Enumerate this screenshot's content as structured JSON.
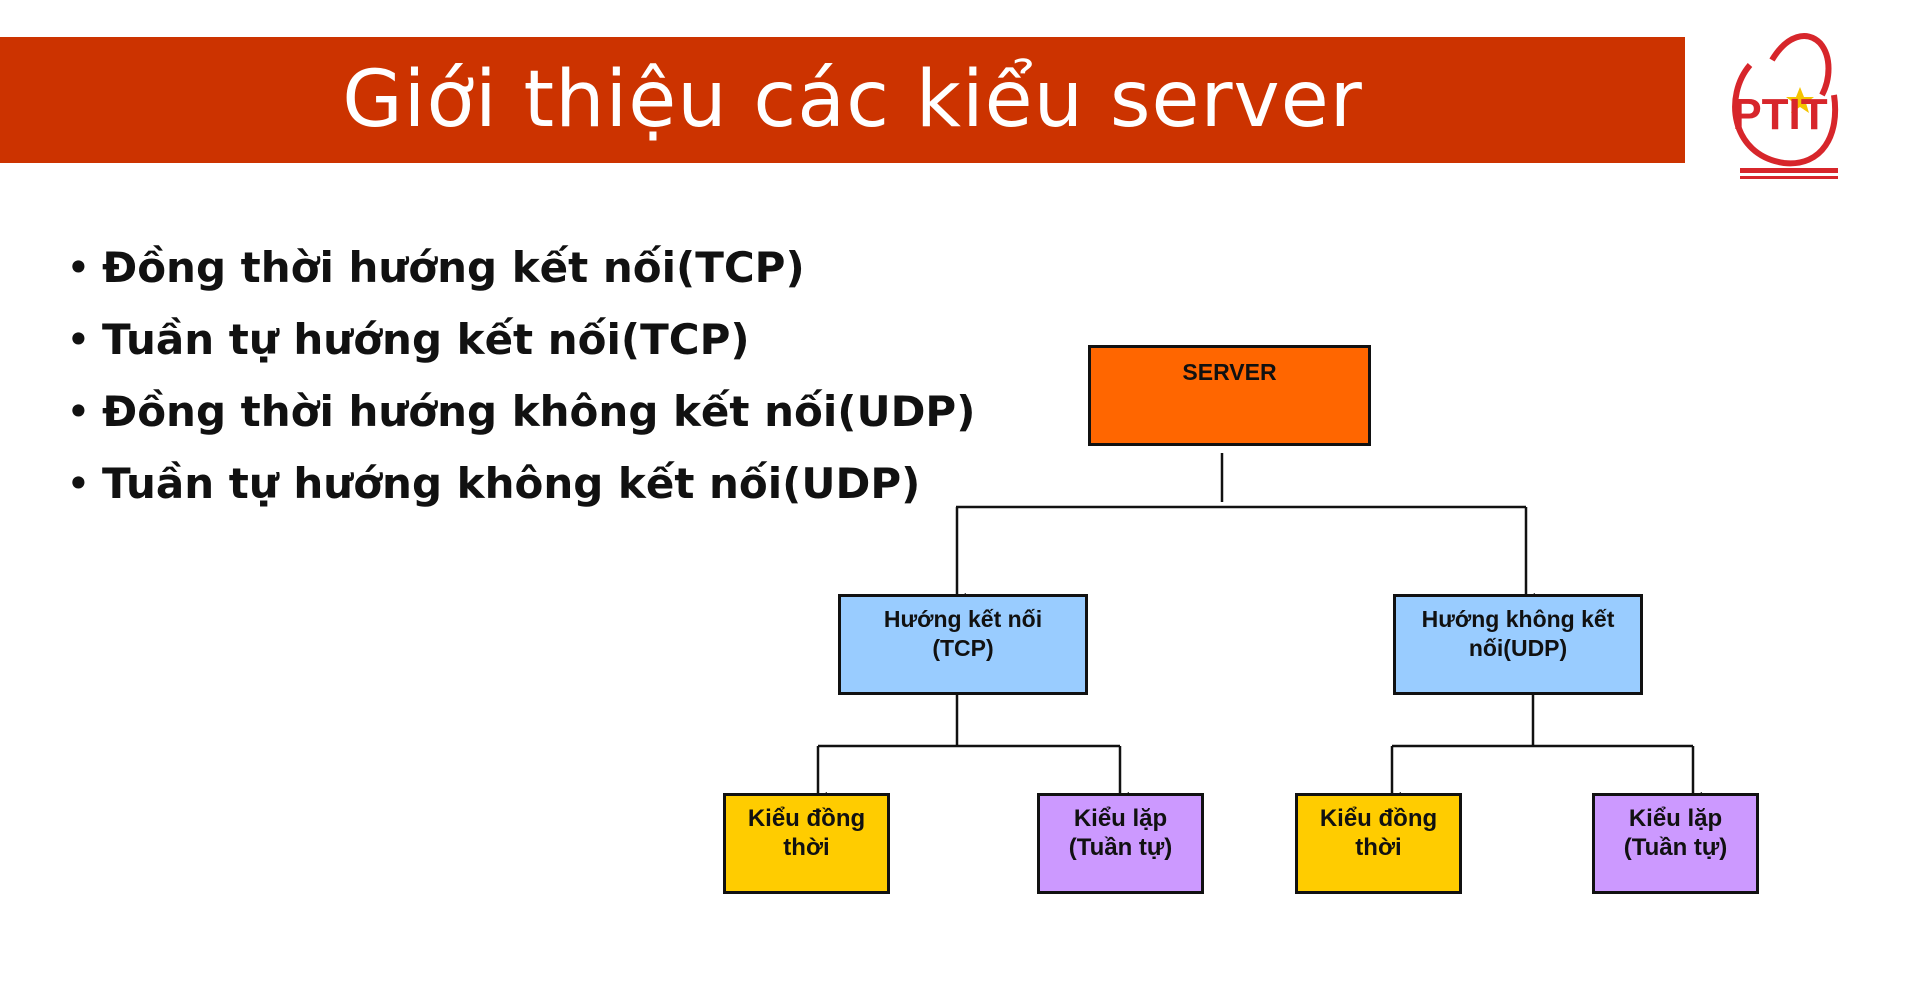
{
  "slide": {
    "title": "Giới thiệu các kiểu server",
    "logo_text": "PTIT",
    "bullets": [
      "Đồng thời hướng kết nối(TCP)",
      "Tuần tự hướng kết nối(TCP)",
      "Đồng thời hướng không kết nối(UDP)",
      "Tuần tự hướng không kết nối(UDP)"
    ]
  },
  "diagram": {
    "root": {
      "label": "SERVER",
      "color": "#ff6600"
    },
    "branches": [
      {
        "label_line1": "Hướng kết nối",
        "label_line2": "(TCP)",
        "color": "#99ccff",
        "children": [
          {
            "line1": "Kiểu đồng",
            "line2": "thời",
            "color": "#ffcc00"
          },
          {
            "line1": "Kiểu lặp",
            "line2": "(Tuần tự)",
            "color": "#cc99ff"
          }
        ]
      },
      {
        "label_line1": "Hướng không kết",
        "label_line2": "nối(UDP)",
        "color": "#99ccff",
        "children": [
          {
            "line1": "Kiểu đồng",
            "line2": "thời",
            "color": "#ffcc00"
          },
          {
            "line1": "Kiểu lặp",
            "line2": "(Tuần tự)",
            "color": "#cc99ff"
          }
        ]
      }
    ]
  },
  "colors": {
    "title_bar": "#cc3300",
    "logo_red": "#d7262b",
    "logo_star": "#f5c400"
  }
}
